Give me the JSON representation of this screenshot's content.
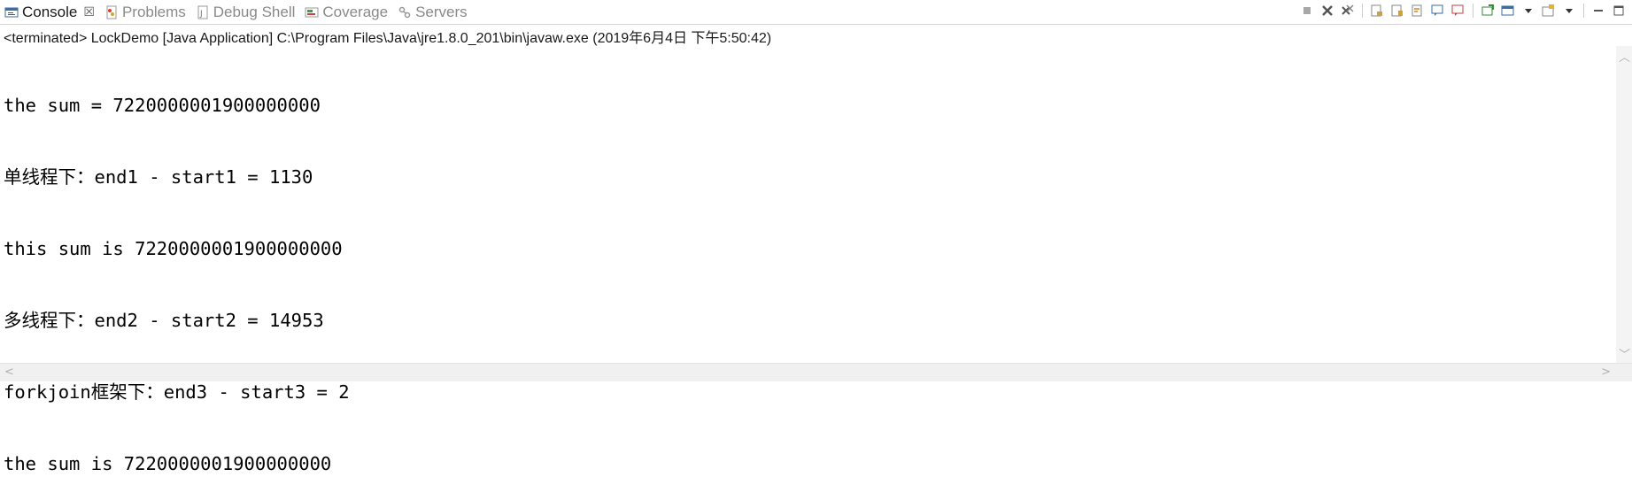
{
  "tabs": [
    {
      "label": "Console",
      "icon": "console-icon",
      "active": true,
      "closable": true
    },
    {
      "label": "Problems",
      "icon": "problems-icon",
      "active": false
    },
    {
      "label": "Debug Shell",
      "icon": "debug-shell-icon",
      "active": false
    },
    {
      "label": "Coverage",
      "icon": "coverage-icon",
      "active": false
    },
    {
      "label": "Servers",
      "icon": "servers-icon",
      "active": false
    }
  ],
  "tab_close_glyph": "☒",
  "status_line": "<terminated> LockDemo [Java Application] C:\\Program Files\\Java\\jre1.8.0_201\\bin\\javaw.exe (2019年6月4日 下午5:50:42)",
  "console_lines": [
    "the sum = 7220000001900000000",
    "单线程下：end1 - start1 = 1130",
    "this sum is 7220000001900000000",
    "多线程下：end2 - start2 = 14953",
    "forkjoin框架下：end3 - start3 = 2",
    "the sum is 7220000001900000000"
  ],
  "toolbar_icons": [
    "terminate-icon",
    "remove-launch-icon",
    "remove-all-terminated-icon",
    "clear-console-icon",
    "scroll-lock-icon",
    "word-wrap-icon",
    "show-on-stdout-icon",
    "show-on-stderr-icon",
    "pin-console-icon",
    "display-console-icon",
    "open-console-icon",
    "minimize-icon",
    "maximize-icon"
  ],
  "colors": {
    "accent": "#1e6fbf",
    "terminate": "#a0a0a0"
  }
}
